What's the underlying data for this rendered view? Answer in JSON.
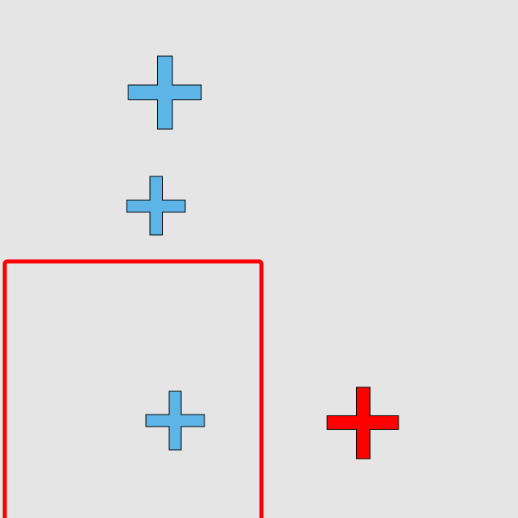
{
  "scene": {
    "background_color": "#e5e5e5",
    "outline_color": "#000000",
    "shapes": [
      {
        "kind": "cross",
        "name": "blue-cross-top",
        "fill": "#5db4e6"
      },
      {
        "kind": "cross",
        "name": "blue-cross-middle",
        "fill": "#5db4e6"
      },
      {
        "kind": "cross",
        "name": "blue-cross-in-box",
        "fill": "#5db4e6"
      },
      {
        "kind": "cross",
        "name": "red-cross",
        "fill": "#ff0000"
      }
    ],
    "highlight_box": {
      "name": "red-highlight-box",
      "stroke": "#ff0000"
    }
  }
}
